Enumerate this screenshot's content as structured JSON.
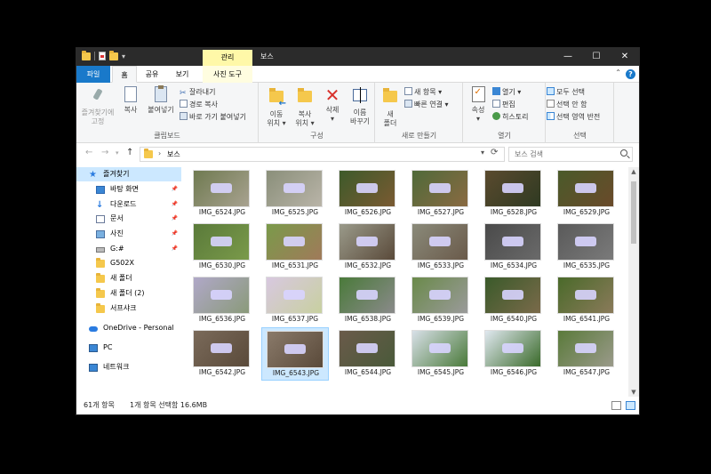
{
  "window": {
    "title": "보스",
    "context_tab": "관리"
  },
  "tabs": [
    {
      "label": "파일"
    },
    {
      "label": "홈"
    },
    {
      "label": "공유"
    },
    {
      "label": "보기"
    },
    {
      "label": "사진 도구"
    }
  ],
  "ribbon": {
    "clipboard": {
      "label": "클립보드",
      "pin_quick": "즐겨찾기에",
      "pin_quick2": "고정",
      "copy": "복사",
      "paste": "붙여넣기",
      "cut": "잘라내기",
      "copy_path": "경로 복사",
      "paste_shortcut": "바로 가기 붙여넣기"
    },
    "organize": {
      "label": "구성",
      "move_to": "이동",
      "move_to2": "위치 ▾",
      "copy_to": "복사",
      "copy_to2": "위치 ▾",
      "delete": "삭제",
      "delete2": "▾",
      "rename": "이름",
      "rename2": "바꾸기"
    },
    "new": {
      "label": "새로 만들기",
      "new_folder": "새",
      "new_folder2": "폴더",
      "new_item": "새 항목 ▾",
      "easy_access": "빠른 연결 ▾"
    },
    "open": {
      "label": "열기",
      "properties": "속성",
      "properties2": "▾",
      "open": "열기 ▾",
      "edit": "편집",
      "history": "히스토리"
    },
    "select": {
      "label": "선택",
      "select_all": "모두 선택",
      "select_none": "선택 안 함",
      "invert": "선택 영역 반전"
    }
  },
  "address": {
    "crumb": "보스"
  },
  "search": {
    "placeholder": "보스 검색"
  },
  "nav": [
    {
      "label": "즐겨찾기",
      "icon": "star-icon",
      "pinned": false,
      "selected": true,
      "indent": 0
    },
    {
      "label": "바탕 화면",
      "icon": "desktop-icon",
      "pinned": true,
      "selected": false,
      "indent": 1
    },
    {
      "label": "다운로드",
      "icon": "download-icon",
      "pinned": true,
      "selected": false,
      "indent": 1
    },
    {
      "label": "문서",
      "icon": "documents-icon",
      "pinned": true,
      "selected": false,
      "indent": 1
    },
    {
      "label": "사진",
      "icon": "pictures-icon",
      "pinned": true,
      "selected": false,
      "indent": 1
    },
    {
      "label": "G:#",
      "icon": "drive-icon",
      "pinned": true,
      "selected": false,
      "indent": 1
    },
    {
      "label": "G502X",
      "icon": "folder-icon",
      "pinned": false,
      "selected": false,
      "indent": 1
    },
    {
      "label": "새 폴더",
      "icon": "folder-icon",
      "pinned": false,
      "selected": false,
      "indent": 1
    },
    {
      "label": "새 폴더 (2)",
      "icon": "folder-icon",
      "pinned": false,
      "selected": false,
      "indent": 1
    },
    {
      "label": "서프샤크",
      "icon": "folder-icon",
      "pinned": false,
      "selected": false,
      "indent": 1
    },
    {
      "label": "OneDrive - Personal",
      "icon": "onedrive-icon",
      "pinned": false,
      "selected": false,
      "indent": 0
    },
    {
      "label": "PC",
      "icon": "pc-icon",
      "pinned": false,
      "selected": false,
      "indent": 0
    },
    {
      "label": "네트워크",
      "icon": "network-icon",
      "pinned": false,
      "selected": false,
      "indent": 0
    }
  ],
  "files": [
    {
      "name": "IMG_6524.JPG",
      "colors": [
        "#6f7a50",
        "#a8a290"
      ],
      "selected": false
    },
    {
      "name": "IMG_6525.JPG",
      "colors": [
        "#8a8f7a",
        "#b9b4a8"
      ],
      "selected": false
    },
    {
      "name": "IMG_6526.JPG",
      "colors": [
        "#3d5a2a",
        "#7a5a32"
      ],
      "selected": false
    },
    {
      "name": "IMG_6527.JPG",
      "colors": [
        "#4f6a3a",
        "#8a6a42"
      ],
      "selected": false
    },
    {
      "name": "IMG_6528.JPG",
      "colors": [
        "#5a4a2e",
        "#2f3a22"
      ],
      "selected": false
    },
    {
      "name": "IMG_6529.JPG",
      "colors": [
        "#4a5a2a",
        "#6a4a2a"
      ],
      "selected": false
    },
    {
      "name": "IMG_6530.JPG",
      "colors": [
        "#5a7a3a",
        "#7a9a4a"
      ],
      "selected": false
    },
    {
      "name": "IMG_6531.JPG",
      "colors": [
        "#7a9a4a",
        "#a07a5a"
      ],
      "selected": false
    },
    {
      "name": "IMG_6532.JPG",
      "colors": [
        "#9a9a8a",
        "#5a4a3a"
      ],
      "selected": false
    },
    {
      "name": "IMG_6533.JPG",
      "colors": [
        "#8a8a7a",
        "#6a5a4a"
      ],
      "selected": false
    },
    {
      "name": "IMG_6534.JPG",
      "colors": [
        "#4a4a4a",
        "#6a6a6a"
      ],
      "selected": false
    },
    {
      "name": "IMG_6535.JPG",
      "colors": [
        "#5a5a5a",
        "#7a7a7a"
      ],
      "selected": false
    },
    {
      "name": "IMG_6536.JPG",
      "colors": [
        "#b0a8c8",
        "#8a9a7a"
      ],
      "selected": false
    },
    {
      "name": "IMG_6537.JPG",
      "colors": [
        "#d8c8e0",
        "#c8d0a0"
      ],
      "selected": false
    },
    {
      "name": "IMG_6538.JPG",
      "colors": [
        "#4a7a3a",
        "#8a8a8a"
      ],
      "selected": false
    },
    {
      "name": "IMG_6539.JPG",
      "colors": [
        "#6a8a4a",
        "#9a9a9a"
      ],
      "selected": false
    },
    {
      "name": "IMG_6540.JPG",
      "colors": [
        "#3a5a2a",
        "#7a6a4a"
      ],
      "selected": false
    },
    {
      "name": "IMG_6541.JPG",
      "colors": [
        "#4a6a2a",
        "#8a7a5a"
      ],
      "selected": false
    },
    {
      "name": "IMG_6542.JPG",
      "colors": [
        "#7a6a5a",
        "#5a4a3a"
      ],
      "selected": false
    },
    {
      "name": "IMG_6543.JPG",
      "colors": [
        "#8a7a6a",
        "#5a4a3a"
      ],
      "selected": true
    },
    {
      "name": "IMG_6544.JPG",
      "colors": [
        "#6a5a4a",
        "#4a5a3a"
      ],
      "selected": false
    },
    {
      "name": "IMG_6545.JPG",
      "colors": [
        "#d8e0e8",
        "#4a7a3a"
      ],
      "selected": false
    },
    {
      "name": "IMG_6546.JPG",
      "colors": [
        "#e0e8f0",
        "#3a6a2a"
      ],
      "selected": false
    },
    {
      "name": "IMG_6547.JPG",
      "colors": [
        "#5a7a3a",
        "#9a9a8a"
      ],
      "selected": false
    }
  ],
  "status": {
    "count": "61개 항목",
    "selection": "1개 항목 선택함 16.6MB"
  }
}
